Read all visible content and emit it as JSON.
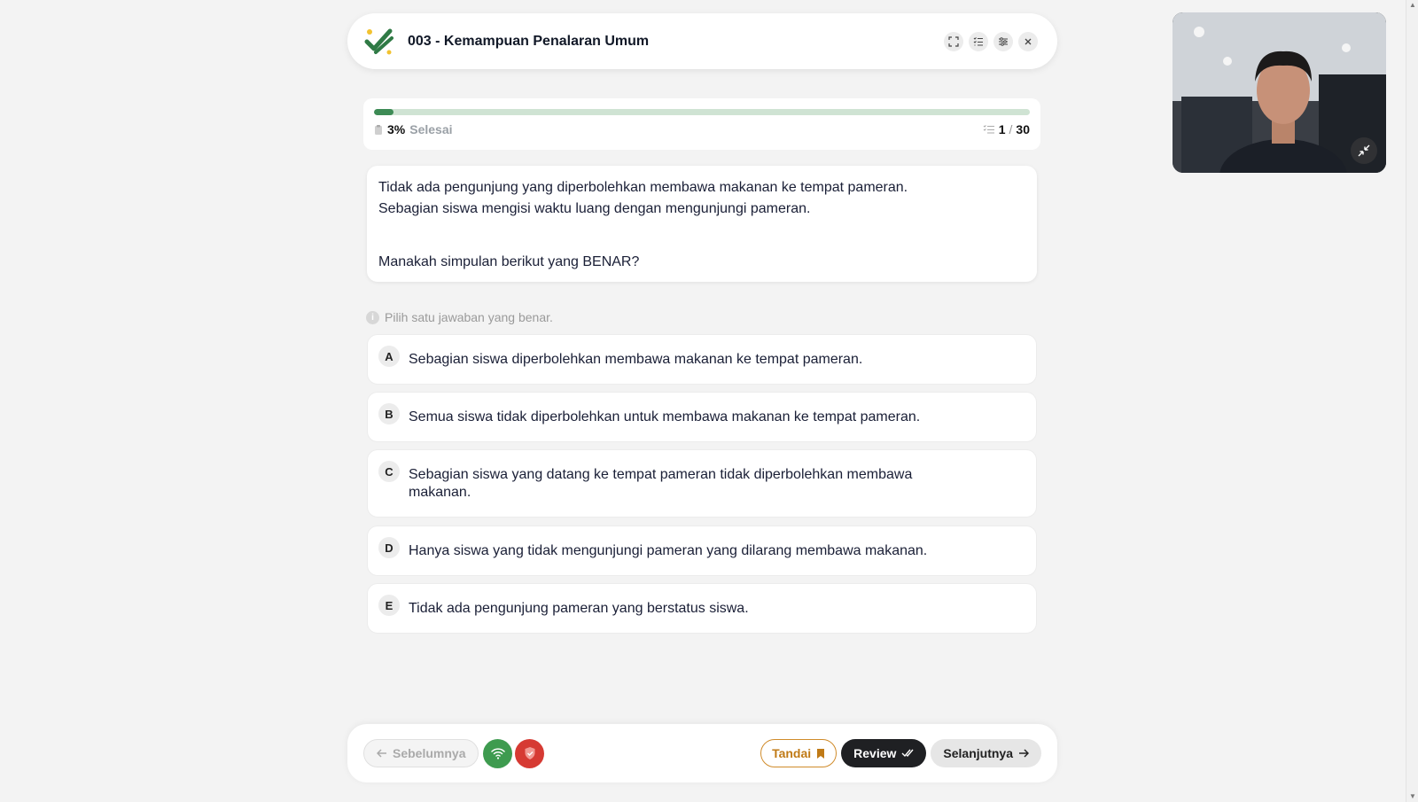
{
  "header": {
    "title": "003 - Kemampuan Penalaran Umum"
  },
  "progress": {
    "percent_label": "3%",
    "done_label": "Selesai",
    "fraction": 0.03,
    "current": "1",
    "separator": "/",
    "total": "30"
  },
  "question": {
    "line1": "Tidak ada pengunjung yang diperbolehkan membawa makanan ke tempat pameran.",
    "line2": "Sebagian siswa mengisi waktu luang dengan mengunjungi pameran.",
    "prompt": "Manakah simpulan berikut yang BENAR?"
  },
  "hint": {
    "text": "Pilih satu jawaban yang benar.",
    "icon": "info-icon"
  },
  "options": [
    {
      "letter": "A",
      "text": "Sebagian siswa diperbolehkan membawa makanan ke tempat pameran."
    },
    {
      "letter": "B",
      "text": "Semua siswa tidak diperbolehkan untuk membawa makanan ke tempat pameran."
    },
    {
      "letter": "C",
      "text": "Sebagian siswa yang datang ke tempat pameran tidak diperbolehkan membawa makanan."
    },
    {
      "letter": "D",
      "text": "Hanya siswa yang tidak mengunjungi pameran yang dilarang membawa makanan."
    },
    {
      "letter": "E",
      "text": "Tidak ada pengunjung pameran yang berstatus siswa."
    }
  ],
  "footer": {
    "prev_label": "Sebelumnya",
    "mark_label": "Tandai",
    "review_label": "Review",
    "next_label": "Selanjutnya"
  },
  "colors": {
    "accent_green": "#3d8b55",
    "danger_red": "#d63a33",
    "mark_orange": "#c07a16",
    "dark": "#1f2023"
  }
}
